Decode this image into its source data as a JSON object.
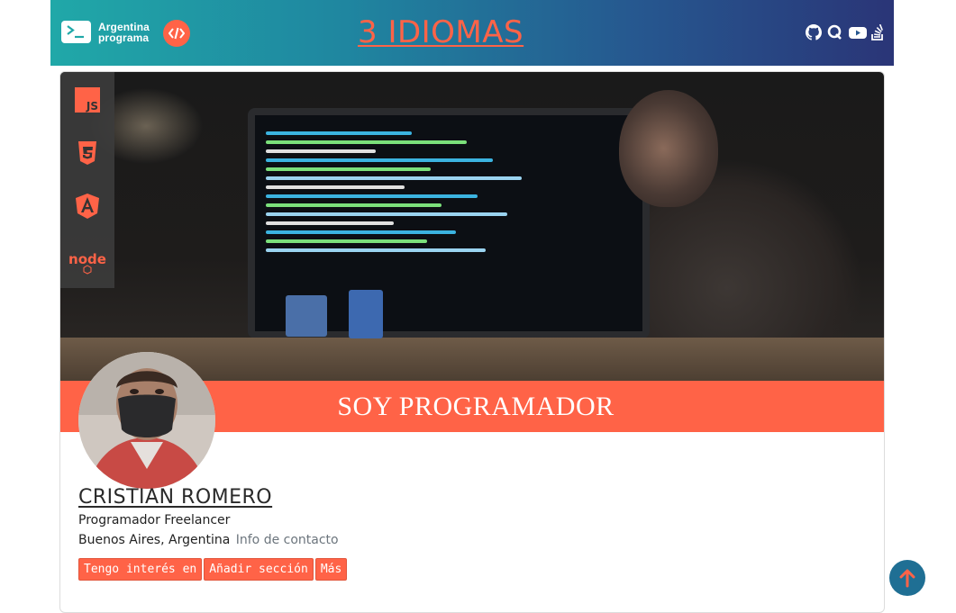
{
  "header": {
    "logo_line1": "Argentina",
    "logo_line2": "programa",
    "brand_title": "3 IDIOMAS",
    "social_icons": [
      "github-icon",
      "quora-icon",
      "youtube-icon",
      "stackoverflow-icon"
    ]
  },
  "banner": {
    "title": "SOY PROGRAMADOR",
    "tech_icons": [
      "js-icon",
      "css3-icon",
      "angular-icon",
      "nodejs-icon"
    ],
    "tech_labels": {
      "js": "JS",
      "node": "node"
    }
  },
  "profile": {
    "name": "CRISTIAN ROMERO",
    "role": "Programador Freelancer",
    "location": "Buenos Aires, Argentina",
    "contact_link": "Info de contacto"
  },
  "actions": [
    {
      "label": "Tengo interés en"
    },
    {
      "label": "Añadir sección"
    },
    {
      "label": "Más"
    }
  ],
  "colors": {
    "accent": "#ff6347",
    "header_start": "#20a8a8",
    "header_end": "#2a3577",
    "scroll_button": "#1f6f94"
  }
}
